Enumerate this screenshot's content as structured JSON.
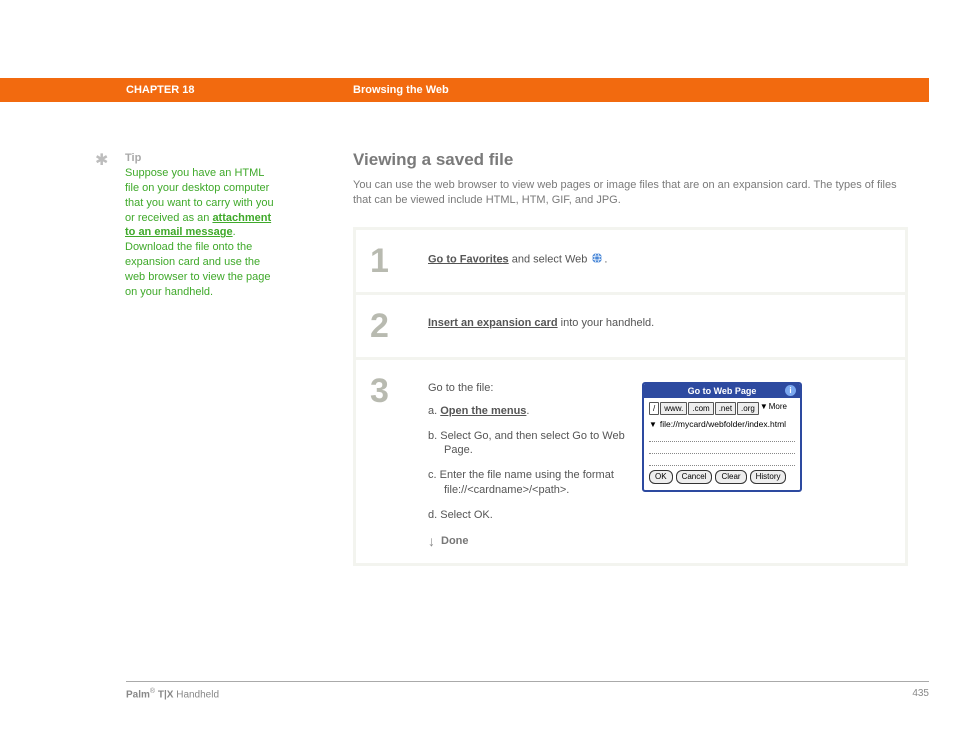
{
  "header": {
    "chapter": "CHAPTER 18",
    "section": "Browsing the Web"
  },
  "tip": {
    "label": "Tip",
    "body_pre": "Suppose you have an HTML file on your desktop computer that you want to carry with you or received as an ",
    "body_link": "attachment to an email message",
    "body_post": ". Download the file onto the expansion card and use the web browser to view the page on your handheld."
  },
  "main": {
    "title": "Viewing a saved file",
    "intro": "You can use the web browser to view web pages or image files that are on an expansion card. The types of files that can be viewed include HTML, HTM, GIF, and JPG."
  },
  "steps": {
    "s1": {
      "num": "1",
      "link": "Go to Favorites",
      "after": " and select Web ",
      "period": "."
    },
    "s2": {
      "num": "2",
      "link": "Insert an expansion card",
      "after": " into your handheld."
    },
    "s3": {
      "num": "3",
      "lead": "Go to the file:",
      "a_prefix": "a.  ",
      "a_link": "Open the menus",
      "a_suffix": ".",
      "b": "b.  Select Go, and then select Go to Web Page.",
      "c": "c.  Enter the file name using the format file://<cardname>/<path>.",
      "d": "d.  Select OK.",
      "done": "Done"
    }
  },
  "dialog": {
    "title": "Go to Web Page",
    "tabs": {
      "slash": "/",
      "www": "www.",
      "com": ".com",
      "net": ".net",
      "org": ".org",
      "more": "More"
    },
    "url": "file://mycard/webfolder/index.html",
    "buttons": {
      "ok": "OK",
      "cancel": "Cancel",
      "clear": "Clear",
      "history": "History"
    }
  },
  "footer": {
    "product_bold": "Palm",
    "product_bold2": " T|X",
    "product_rest": " Handheld",
    "page": "435"
  }
}
